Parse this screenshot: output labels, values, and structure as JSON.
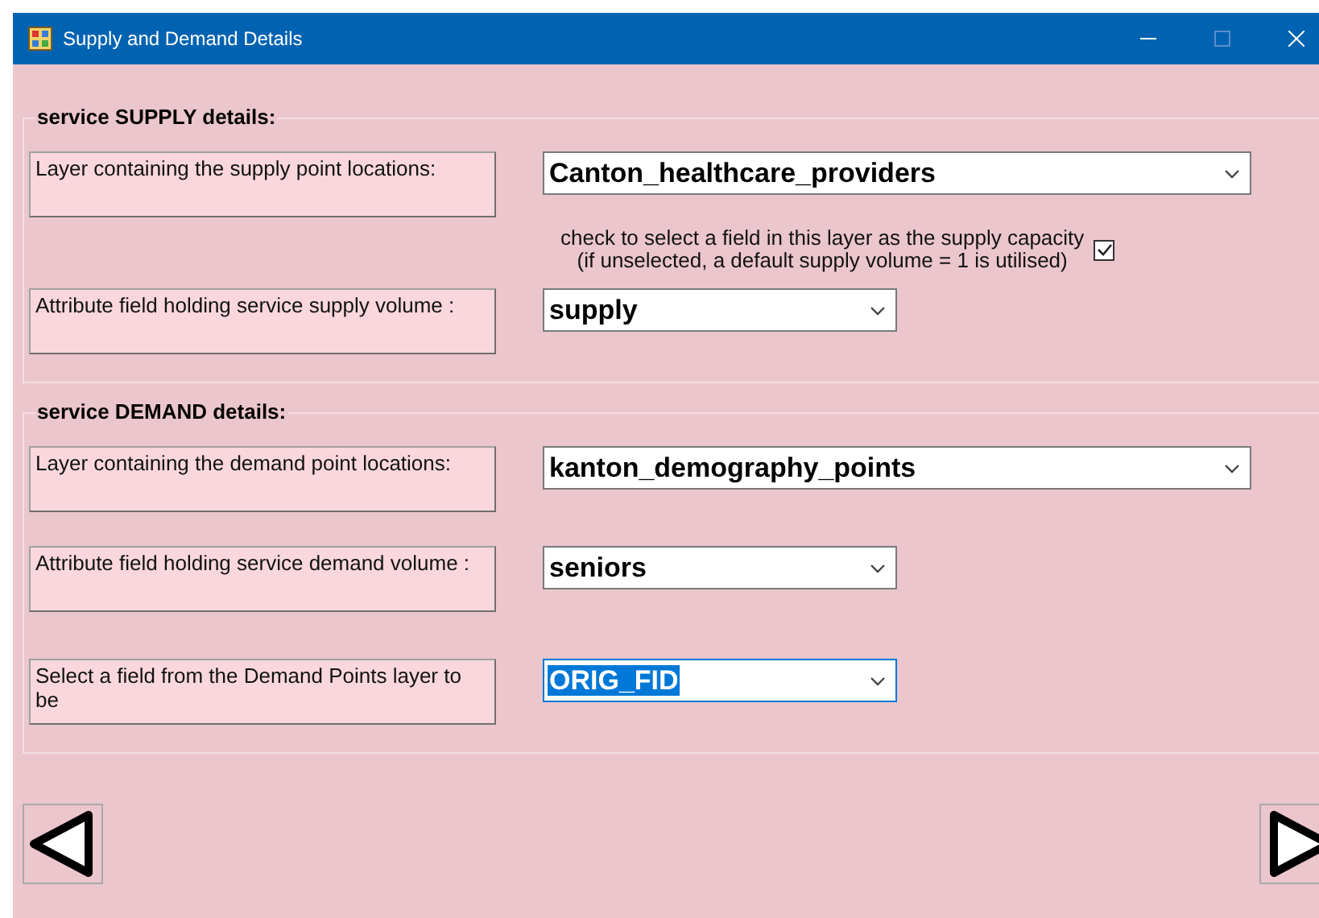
{
  "window": {
    "title": "Supply and Demand Details"
  },
  "sections": [
    {
      "title": "service SUPPLY details:",
      "rows": [
        {
          "kind": "layer",
          "label": "Layer containing the supply point locations:",
          "value": "Canton_healthcare_providers",
          "selected": false
        },
        {
          "kind": "checkbox",
          "lines": [
            "check to select a field in this layer as the supply capacity",
            "(if unselected, a default supply volume = 1 is utilised)"
          ],
          "checked": true
        },
        {
          "kind": "field",
          "label": "Attribute field holding service supply volume :",
          "value": "supply",
          "selected": false
        }
      ]
    },
    {
      "title": "service DEMAND details:",
      "rows": [
        {
          "kind": "layer",
          "label": "Layer containing the demand point locations:",
          "value": "kanton_demography_points",
          "selected": false
        },
        {
          "kind": "field",
          "label": "Attribute field holding service demand volume :",
          "value": "seniors",
          "selected": false
        },
        {
          "kind": "field",
          "label": "Select a field from the Demand Points layer to be",
          "value": "ORIG_FID",
          "selected": true
        }
      ]
    }
  ],
  "navigation": [
    {
      "kind": "back"
    },
    {
      "kind": "next"
    }
  ]
}
